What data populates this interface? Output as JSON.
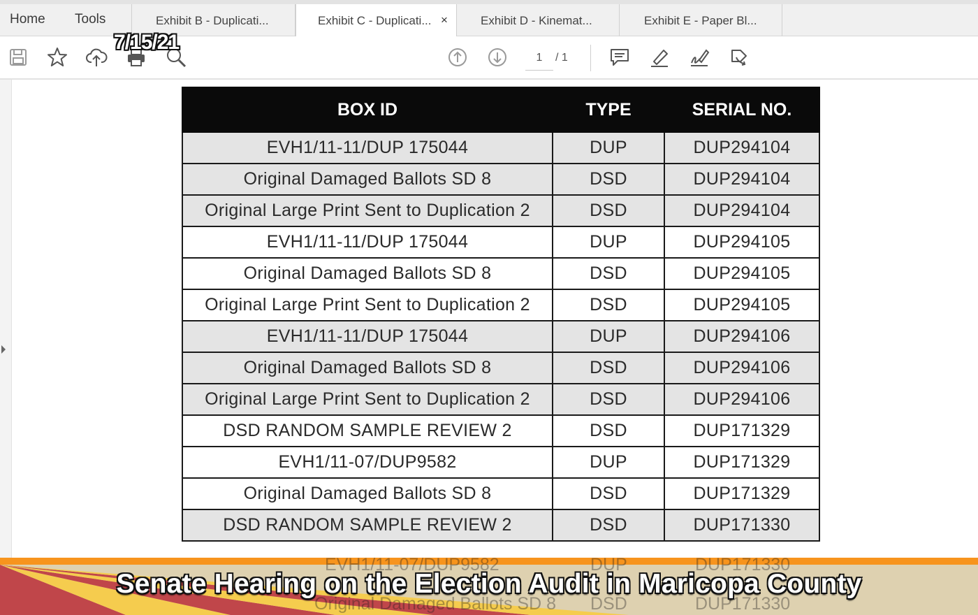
{
  "nav": {
    "home": "Home",
    "tools": "Tools"
  },
  "tabs": [
    {
      "label": "Exhibit B - Duplicati...",
      "active": false
    },
    {
      "label": "Exhibit C - Duplicati...",
      "active": true,
      "close": "×"
    },
    {
      "label": "Exhibit D - Kinemat...",
      "active": false
    },
    {
      "label": "Exhibit E - Paper Bl...",
      "active": false
    }
  ],
  "toolbar": {
    "icons": [
      "save-icon",
      "star-icon",
      "cloud-upload-icon",
      "print-icon",
      "zoom-icon",
      "page-up-icon",
      "page-down-icon",
      "comment-icon",
      "highlight-pen-icon",
      "sign-icon",
      "share-icon"
    ],
    "page_current": "1",
    "page_total": "/ 1"
  },
  "stamp_date": "7/15/21",
  "table": {
    "headers": [
      "BOX ID",
      "TYPE",
      "SERIAL NO."
    ],
    "rows": [
      {
        "box_id": "EVH1/11-11/DUP 175044",
        "type": "DUP",
        "serial": "DUP294104",
        "shade": "grey"
      },
      {
        "box_id": "Original Damaged Ballots SD 8",
        "type": "DSD",
        "serial": "DUP294104",
        "shade": "grey"
      },
      {
        "box_id": "Original Large Print Sent to Duplication  2",
        "type": "DSD",
        "serial": "DUP294104",
        "shade": "grey"
      },
      {
        "box_id": "EVH1/11-11/DUP 175044",
        "type": "DUP",
        "serial": "DUP294105",
        "shade": "white"
      },
      {
        "box_id": "Original Damaged Ballots SD 8",
        "type": "DSD",
        "serial": "DUP294105",
        "shade": "white"
      },
      {
        "box_id": "Original Large Print Sent to Duplication  2",
        "type": "DSD",
        "serial": "DUP294105",
        "shade": "white"
      },
      {
        "box_id": "EVH1/11-11/DUP 175044",
        "type": "DUP",
        "serial": "DUP294106",
        "shade": "grey"
      },
      {
        "box_id": "Original Damaged Ballots SD 8",
        "type": "DSD",
        "serial": "DUP294106",
        "shade": "grey"
      },
      {
        "box_id": "Original Large Print Sent to Duplication  2",
        "type": "DSD",
        "serial": "DUP294106",
        "shade": "grey"
      },
      {
        "box_id": "DSD RANDOM SAMPLE REVIEW 2",
        "type": "DSD",
        "serial": "DUP171329",
        "shade": "white"
      },
      {
        "box_id": "EVH1/11-07/DUP9582",
        "type": "DUP",
        "serial": "DUP171329",
        "shade": "white"
      },
      {
        "box_id": "Original Damaged Ballots SD 8",
        "type": "DSD",
        "serial": "DUP171329",
        "shade": "white"
      },
      {
        "box_id": "DSD RANDOM SAMPLE REVIEW 2",
        "type": "DSD",
        "serial": "DUP171330",
        "shade": "grey"
      }
    ],
    "partial_rows": [
      {
        "box_id": "EVH1/11-07/DUP9582",
        "type": "DUP",
        "serial": "DUP171330"
      },
      {
        "box_id": "Original Damaged Ballots SD 8",
        "type": "DSD",
        "serial": "DUP171330"
      }
    ]
  },
  "banner": {
    "title": "Senate Hearing on the Election Audit in Maricopa County",
    "colors": {
      "stripe": "#f7941d",
      "red": "#b5262b",
      "yellow": "#f4c430",
      "blue": "#1c3f94"
    }
  }
}
